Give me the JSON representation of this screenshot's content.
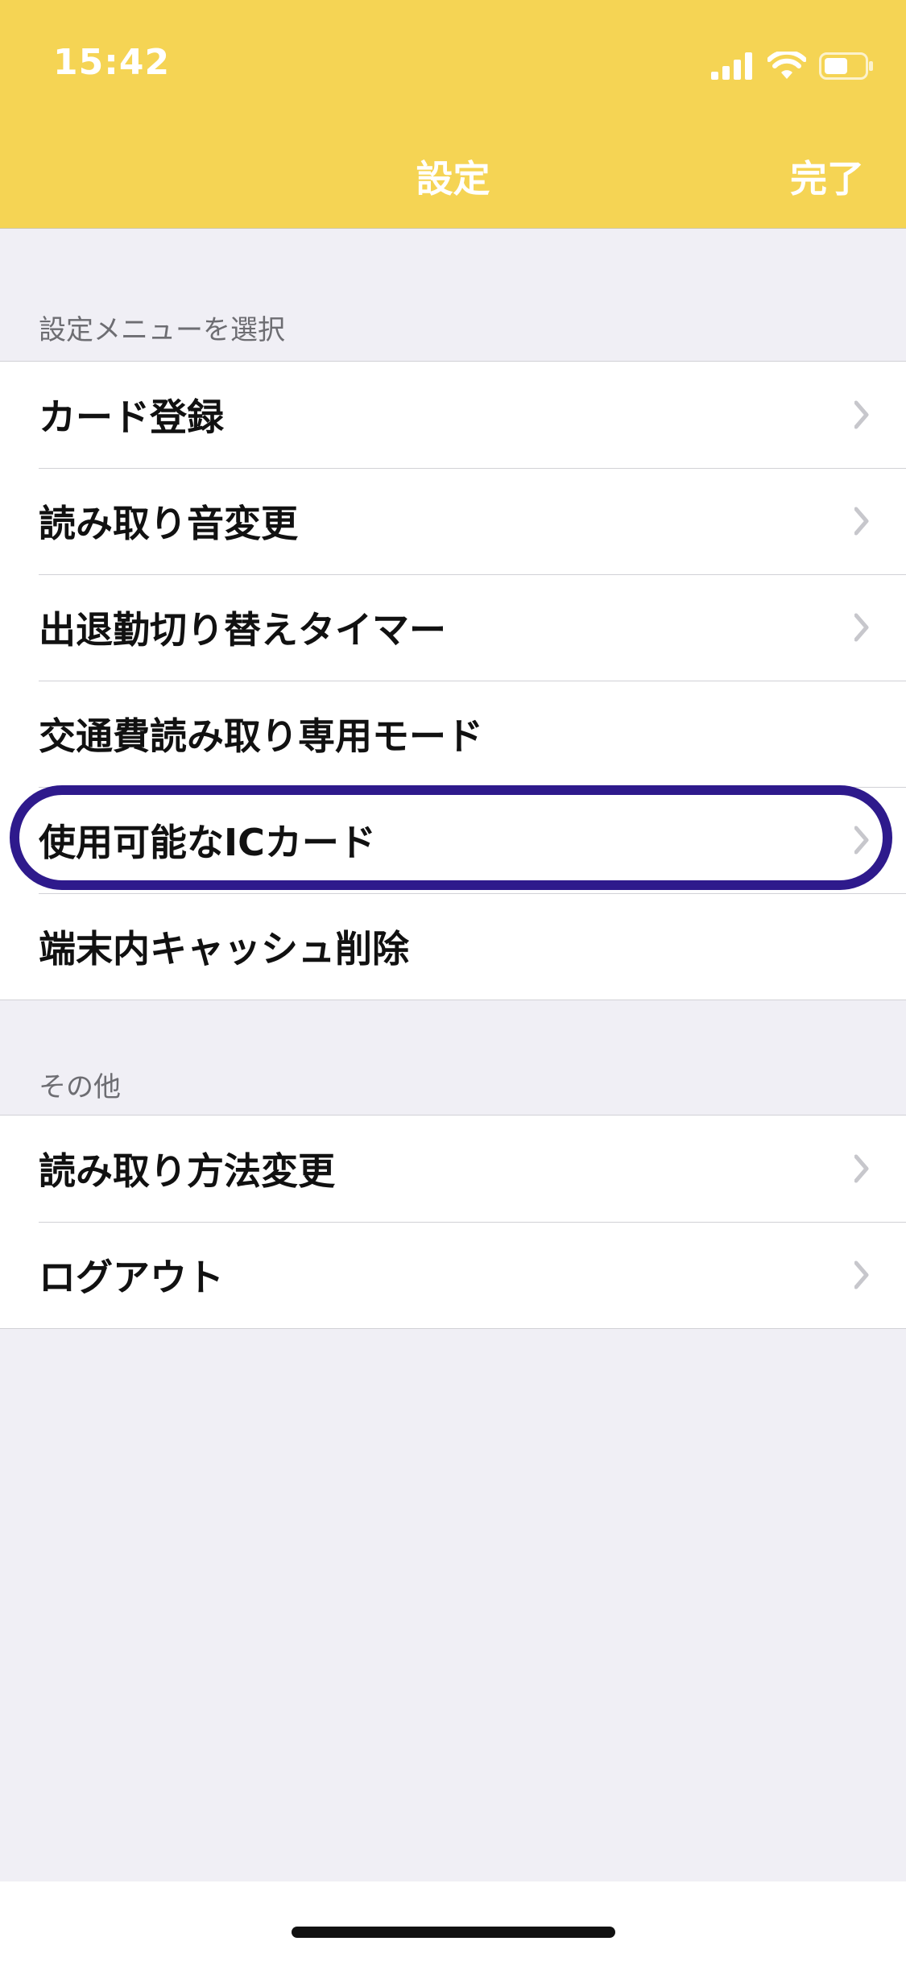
{
  "status_bar": {
    "time": "15:42",
    "icons": [
      "cellular-signal-icon",
      "wifi-icon",
      "battery-icon"
    ]
  },
  "nav": {
    "title": "設定",
    "done_label": "完了"
  },
  "sections": {
    "settings_menu": {
      "header": "設定メニューを選択",
      "items": [
        {
          "label": "カード登録",
          "chevron": true
        },
        {
          "label": "読み取り音変更",
          "chevron": true
        },
        {
          "label": "出退勤切り替えタイマー",
          "chevron": true
        },
        {
          "label": "交通費読み取り専用モード",
          "chevron": false
        },
        {
          "label": "使用可能なICカード",
          "chevron": true,
          "highlighted": true
        },
        {
          "label": "端末内キャッシュ削除",
          "chevron": false
        }
      ]
    },
    "other": {
      "header": "その他",
      "items": [
        {
          "label": "読み取り方法変更",
          "chevron": true
        },
        {
          "label": "ログアウト",
          "chevron": true
        }
      ]
    }
  },
  "colors": {
    "header_bg": "#F5D454",
    "page_bg": "#F0EFF5",
    "highlight": "#2E1A8C",
    "chevron": "#C7C7CC"
  }
}
